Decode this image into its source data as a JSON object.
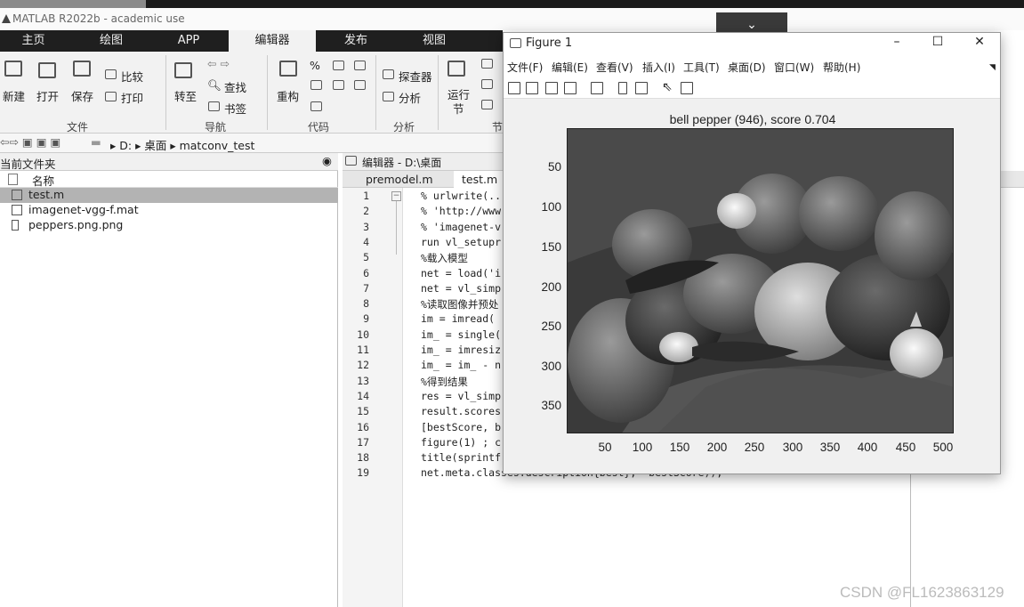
{
  "app": {
    "title": "MATLAB R2022b - academic use"
  },
  "ribbon_tabs": [
    "主页",
    "绘图",
    "APP",
    "编辑器",
    "发布",
    "视图"
  ],
  "ribbon": {
    "new": "新建",
    "open": "打开",
    "save": "保存",
    "compare": "比较",
    "print": "打印",
    "goto": "转至",
    "find": "查找",
    "bookmark": "书签",
    "refactor": "重构",
    "percent": "%",
    "inspector": "探查器",
    "analyze": "分析",
    "run_section_1": "运行",
    "run_section_2": "节",
    "sec_file": "文件",
    "sec_nav": "导航",
    "sec_code": "代码",
    "sec_analyze": "分析",
    "sec_section": "节"
  },
  "address": {
    "drive": "D:",
    "folder1": "桌面",
    "folder2": "matconv_test"
  },
  "file_browser": {
    "header": "当前文件夹",
    "column": "名称",
    "files": [
      {
        "name": "test.m",
        "selected": true
      },
      {
        "name": "imagenet-vgg-f.mat",
        "selected": false
      },
      {
        "name": "peppers.png.png",
        "selected": false
      }
    ]
  },
  "editor": {
    "header": "编辑器 - D:\\桌面\\matconv_te",
    "tabs": [
      {
        "label": "premodel.m",
        "active": false
      },
      {
        "label": "test.m",
        "active": true
      }
    ],
    "tab_close": "×",
    "lines": [
      "% urlwrite(..",
      "% 'http://www",
      "% 'imagenet-v",
      "run vl_setupr",
      "%载入模型",
      "net = load('i",
      "net = vl_simp",
      "%读取图像并预处",
      "im = imread(",
      "im_ = single(",
      "im_ = imresiz",
      "im_ = im_ - n",
      "%得到结果",
      "res = vl_simp",
      "result.scores",
      "[bestScore, b",
      "figure(1) ; c",
      "title(sprintf",
      "net.meta.classes.description{best},  bestScore));"
    ]
  },
  "figure": {
    "title": "Figure 1",
    "menu": [
      "文件(F)",
      "编辑(E)",
      "查看(V)",
      "插入(I)",
      "工具(T)",
      "桌面(D)",
      "窗口(W)",
      "帮助(H)"
    ],
    "plot_title": "bell pepper (946), score 0.704",
    "yticks": [
      "50",
      "100",
      "150",
      "200",
      "250",
      "300",
      "350"
    ],
    "xticks": [
      "50",
      "100",
      "150",
      "200",
      "250",
      "300",
      "350",
      "400",
      "450",
      "500"
    ],
    "image_subject": "peppers grayscale photo"
  },
  "watermark": "CSDN @FL1623863129"
}
